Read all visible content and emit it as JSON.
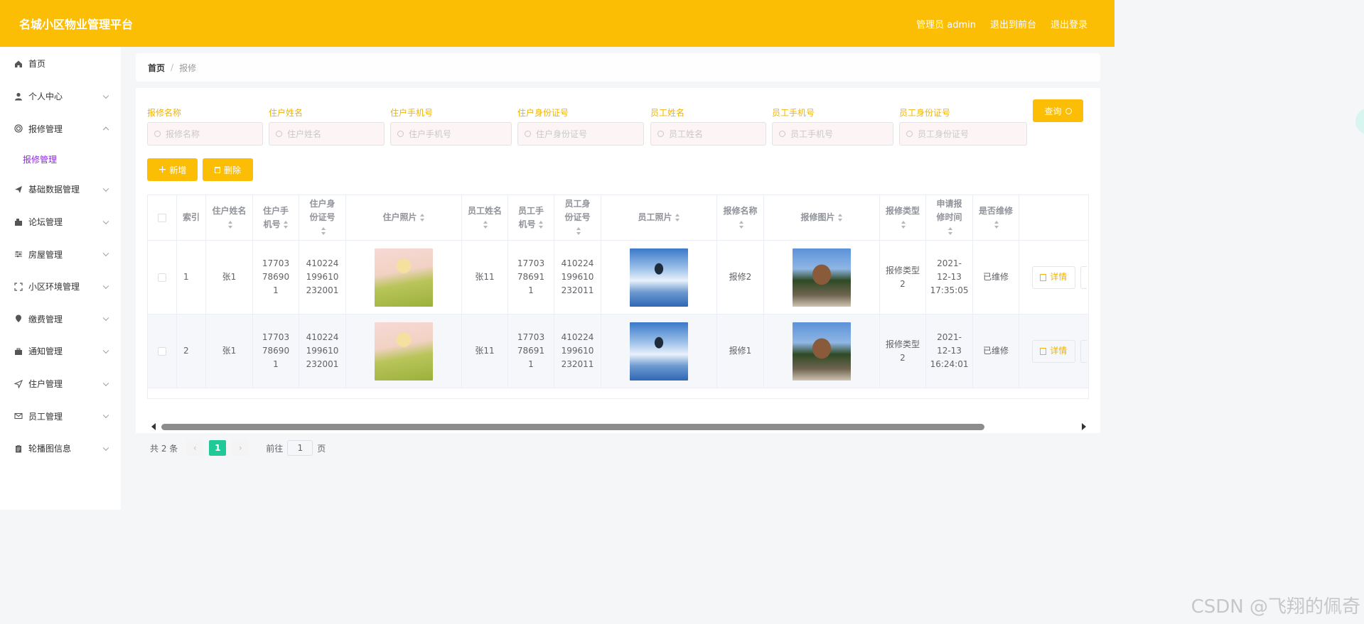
{
  "header": {
    "title": "名城小区物业管理平台",
    "links": [
      "管理员 admin",
      "退出到前台",
      "退出登录"
    ]
  },
  "sidebar": {
    "items": [
      {
        "label": "首页",
        "icon": "home-icon"
      },
      {
        "label": "个人中心",
        "icon": "user-icon"
      },
      {
        "label": "报修管理",
        "icon": "ring-icon",
        "expanded": true,
        "sub": "报修管理"
      },
      {
        "label": "基础数据管理",
        "icon": "send-icon"
      },
      {
        "label": "论坛管理",
        "icon": "forum-icon"
      },
      {
        "label": "房屋管理",
        "icon": "sliders-icon"
      },
      {
        "label": "小区环境管理",
        "icon": "frame-icon"
      },
      {
        "label": "缴费管理",
        "icon": "pin-icon"
      },
      {
        "label": "通知管理",
        "icon": "briefcase-icon"
      },
      {
        "label": "住户管理",
        "icon": "navigation-icon"
      },
      {
        "label": "员工管理",
        "icon": "mail-icon"
      },
      {
        "label": "轮播图信息",
        "icon": "clipboard-icon"
      }
    ]
  },
  "breadcrumb": {
    "home": "首页",
    "sep": "/",
    "current": "报修"
  },
  "search": {
    "fields": [
      {
        "label": "报修名称",
        "placeholder": "报修名称"
      },
      {
        "label": "住户姓名",
        "placeholder": "住户姓名"
      },
      {
        "label": "住户手机号",
        "placeholder": "住户手机号"
      },
      {
        "label": "住户身份证号",
        "placeholder": "住户身份证号"
      },
      {
        "label": "员工姓名",
        "placeholder": "员工姓名"
      },
      {
        "label": "员工手机号",
        "placeholder": "员工手机号"
      },
      {
        "label": "员工身份证号",
        "placeholder": "员工身份证号"
      }
    ],
    "query_label": "查询"
  },
  "actions": {
    "add_label": "新增",
    "delete_label": "删除"
  },
  "table": {
    "columns": [
      "索引",
      "住户姓名",
      "住户手机号",
      "住户身份证号",
      "住户照片",
      "员工姓名",
      "员工手机号",
      "员工身份证号",
      "员工照片",
      "报修名称",
      "报修图片",
      "报修类型",
      "申请报修时间",
      "是否维修"
    ],
    "rows": [
      {
        "index": "1",
        "resident_name": "张1",
        "resident_phone": "17703786901",
        "resident_id": "410224199610232001",
        "staff_name": "张11",
        "staff_phone": "17703786911",
        "staff_id": "410224199610232011",
        "repair_name": "报修2",
        "repair_type": "报修类型2",
        "apply_time": "2021-12-13 17:35:05",
        "repaired": "已维修",
        "detail": "详情"
      },
      {
        "index": "2",
        "resident_name": "张1",
        "resident_phone": "17703786901",
        "resident_id": "410224199610232001",
        "staff_name": "张11",
        "staff_phone": "17703786911",
        "staff_id": "410224199610232011",
        "repair_name": "报修1",
        "repair_type": "报修类型2",
        "apply_time": "2021-12-13 16:24:01",
        "repaired": "已维修",
        "detail": "详情"
      }
    ]
  },
  "pager": {
    "total": "共 2 条",
    "current": "1",
    "goto": "前往",
    "goto_value": "1",
    "page_unit": "页"
  },
  "colors": {
    "accent": "#fcbd05",
    "active_page": "#20c997",
    "submenu": "#8a2be2"
  },
  "watermark": "CSDN @飞翔的佩奇"
}
